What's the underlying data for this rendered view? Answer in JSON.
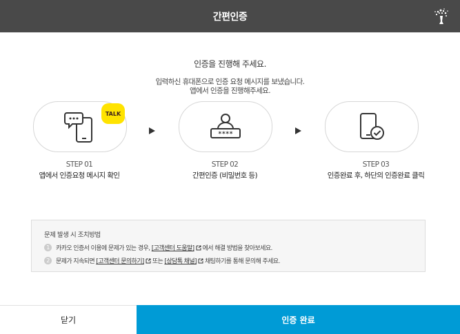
{
  "header": {
    "title": "간편인증",
    "logo_icon": "tree-logo-icon"
  },
  "intro": {
    "title": "인증을 진행해 주세요.",
    "desc_line1": "입력하신 휴대폰으로 인증 요청 메시지를 보냈습니다.",
    "desc_line2": "앱에서 인증을 진행해주세요."
  },
  "steps": [
    {
      "num": "STEP 01",
      "desc": "앱에서 인증요청 메시지 확인",
      "icon": "phone-message-icon",
      "badge": "TALK"
    },
    {
      "num": "STEP 02",
      "desc": "간편인증 (비밀번호 등)",
      "icon": "user-password-icon"
    },
    {
      "num": "STEP 03",
      "desc": "인증완료 후, 하단의 인증완료 클릭",
      "icon": "phone-check-icon"
    }
  ],
  "notice": {
    "title": "문제 발생 시 조치방법",
    "items": [
      {
        "num": "1",
        "pre": "카카오 인증서 이용에 문제가 있는 경우,",
        "link1": "[고객센터 도움말]",
        "post": "에서 해결 방법을 찾아보세요."
      },
      {
        "num": "2",
        "pre": "문제가 지속되면",
        "link1": "[고객센터 문의하기]",
        "mid": "또는",
        "link2": "[상담톡 채널]",
        "post": "채팅하기를 통해 문의해 주세요."
      }
    ]
  },
  "footer": {
    "close_label": "닫기",
    "done_label": "인증 완료"
  },
  "colors": {
    "header_bg": "#494949",
    "primary": "#009bd6",
    "talk_yellow": "#ffe300"
  }
}
